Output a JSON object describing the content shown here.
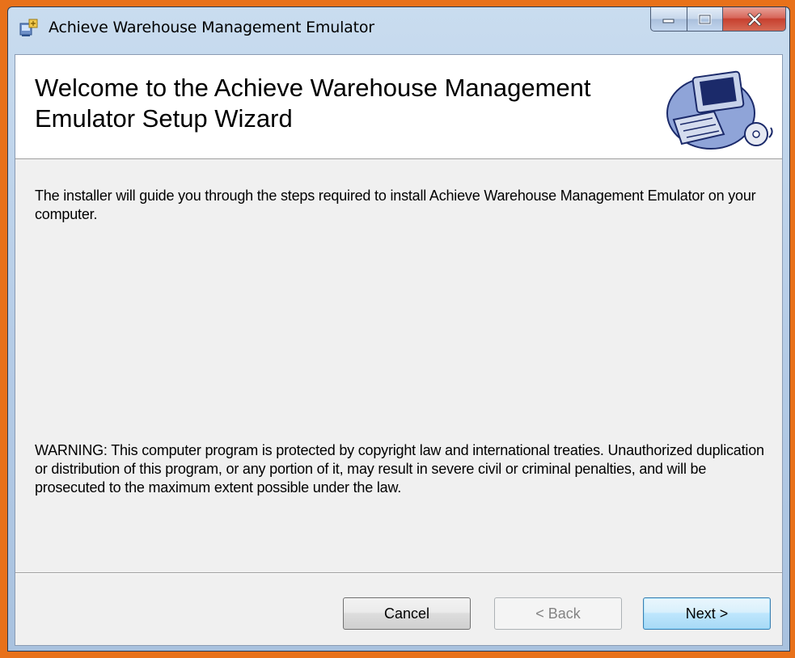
{
  "window": {
    "title": "Achieve Warehouse Management Emulator",
    "icon": "installer-icon",
    "caption_buttons": [
      "minimize-icon",
      "maximize-icon",
      "close-icon"
    ]
  },
  "banner": {
    "title": "Welcome to the Achieve Warehouse Management Emulator Setup Wizard",
    "graphic": "computer-cd-icon"
  },
  "content": {
    "intro": "The installer will guide you through the steps required to install Achieve Warehouse Management Emulator on your computer.",
    "warning": "WARNING: This computer program is protected by copyright law and international treaties. Unauthorized duplication or distribution of this program, or any portion of it, may result in severe civil or criminal penalties, and will be prosecuted to the maximum extent possible under the law."
  },
  "buttons": {
    "cancel": "Cancel",
    "back": "< Back",
    "next": "Next >"
  },
  "colors": {
    "background_frame": "#e8711a",
    "client": "#f0f0f0",
    "banner": "#ffffff",
    "close_button": "#c7402f"
  }
}
